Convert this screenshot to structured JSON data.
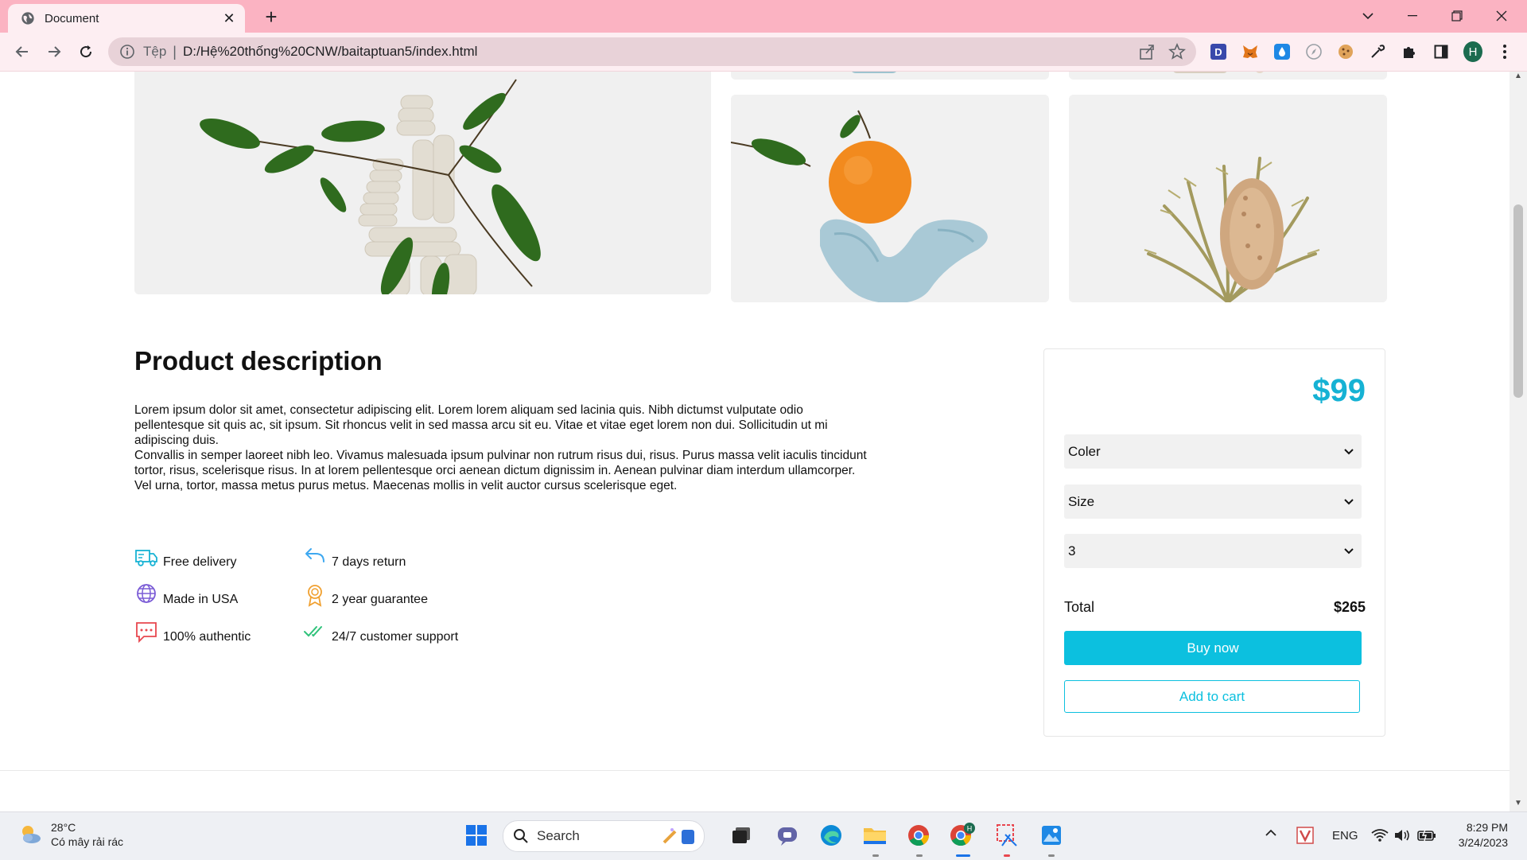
{
  "browser": {
    "tab_title": "Document",
    "omnibox_label": "Tệp",
    "url": "D:/Hệ%20thống%20CNW/baitaptuan5/index.html",
    "profile_initial": "H"
  },
  "product": {
    "description_title": "Product description",
    "description_paragraphs": [
      "Lorem ipsum dolor sit amet, consectetur adipiscing elit. Lorem lorem aliquam sed lacinia quis. Nibh dictumst vulputate odio pellentesque sit quis ac, sit ipsum. Sit rhoncus velit in sed massa arcu sit eu. Vitae et vitae eget lorem non dui. Sollicitudin ut mi adipiscing duis.",
      "Convallis in semper laoreet nibh leo. Vivamus malesuada ipsum pulvinar non rutrum risus dui, risus. Purus massa velit iaculis tincidunt tortor, risus, scelerisque risus. In at lorem pellentesque orci aenean dictum dignissim in. Aenean pulvinar diam interdum ullamcorper. Vel urna, tortor, massa metus purus metus. Maecenas mollis in velit auctor cursus scelerisque eget."
    ],
    "features": [
      {
        "label": "Free delivery",
        "icon": "truck-icon",
        "color": "#16b2d4"
      },
      {
        "label": "7 days return",
        "icon": "return-arrow-icon",
        "color": "#3ea8f0"
      },
      {
        "label": "Made in USA",
        "icon": "globe-icon",
        "color": "#7b5cd6"
      },
      {
        "label": "2 year guarantee",
        "icon": "award-medal-icon",
        "color": "#f0a030"
      },
      {
        "label": "100% authentic",
        "icon": "chat-bubble-icon",
        "color": "#e8474f"
      },
      {
        "label": "24/7 customer support",
        "icon": "double-check-icon",
        "color": "#2fc27a"
      }
    ]
  },
  "purchase": {
    "price": "$99",
    "color_select": "Coler",
    "size_select": "Size",
    "quantity_select": "3",
    "total_label": "Total",
    "total_value": "$265",
    "buy_label": "Buy now",
    "cart_label": "Add to cart",
    "accent_color": "#0cc0df"
  },
  "taskbar": {
    "temperature": "28°C",
    "weather_desc": "Có mây rải rác",
    "search_label": "Search",
    "language": "ENG",
    "time": "8:29 PM",
    "date": "3/24/2023"
  }
}
